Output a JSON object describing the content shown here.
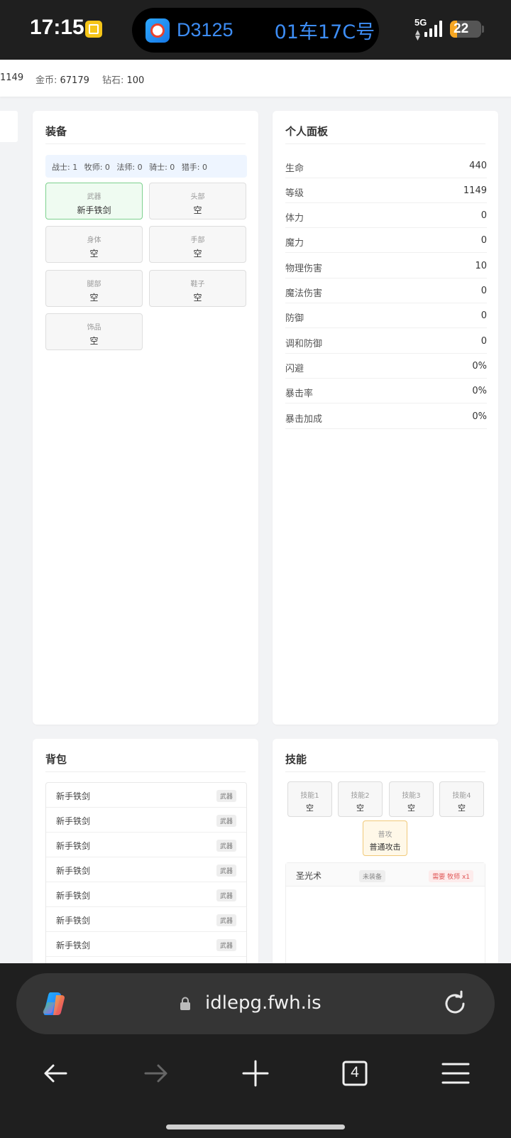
{
  "status_bar": {
    "time": "17:15",
    "train_number": "D3125",
    "seat": "01车17C号",
    "network": "5G",
    "battery_level": "22",
    "battery_fraction": 0.22
  },
  "top_stats": {
    "level_fragment": "1149",
    "gold_label": "金币: ",
    "gold_value": "67179",
    "diamond_label": "钻石: ",
    "diamond_value": "100"
  },
  "equipment": {
    "title": "装备",
    "job_counts": [
      "战士: 1",
      "牧师: 0",
      "法师: 0",
      "骑士: 0",
      "猎手: 0"
    ],
    "slots": [
      {
        "name": "武器",
        "value": "新手铁剑",
        "equipped": true
      },
      {
        "name": "头部",
        "value": "空",
        "equipped": false
      },
      {
        "name": "身体",
        "value": "空",
        "equipped": false
      },
      {
        "name": "手部",
        "value": "空",
        "equipped": false
      },
      {
        "name": "腿部",
        "value": "空",
        "equipped": false
      },
      {
        "name": "鞋子",
        "value": "空",
        "equipped": false
      },
      {
        "name": "饰品",
        "value": "空",
        "equipped": false
      }
    ]
  },
  "personal_panel": {
    "title": "个人面板",
    "stats": [
      {
        "label": "生命",
        "value": "440"
      },
      {
        "label": "等级",
        "value": "1149"
      },
      {
        "label": "体力",
        "value": "0"
      },
      {
        "label": "魔力",
        "value": "0"
      },
      {
        "label": "物理伤害",
        "value": "10"
      },
      {
        "label": "魔法伤害",
        "value": "0"
      },
      {
        "label": "防御",
        "value": "0"
      },
      {
        "label": "调和防御",
        "value": "0"
      },
      {
        "label": "闪避",
        "value": "0%"
      },
      {
        "label": "暴击率",
        "value": "0%"
      },
      {
        "label": "暴击加成",
        "value": "0%"
      }
    ]
  },
  "backpack": {
    "title": "背包",
    "items": [
      {
        "name": "新手铁剑",
        "tag": "武器"
      },
      {
        "name": "新手铁剑",
        "tag": "武器"
      },
      {
        "name": "新手铁剑",
        "tag": "武器"
      },
      {
        "name": "新手铁剑",
        "tag": "武器"
      },
      {
        "name": "新手铁剑",
        "tag": "武器"
      },
      {
        "name": "新手铁剑",
        "tag": "武器"
      },
      {
        "name": "新手铁剑",
        "tag": "武器"
      }
    ]
  },
  "skills": {
    "title": "技能",
    "slots": [
      {
        "name": "技能1",
        "value": "空"
      },
      {
        "name": "技能2",
        "value": "空"
      },
      {
        "name": "技能3",
        "value": "空"
      },
      {
        "name": "技能4",
        "value": "空"
      }
    ],
    "basic": {
      "name": "普攻",
      "value": "普通攻击"
    },
    "list": [
      {
        "name": "圣光术",
        "status": "未装备",
        "requirement": "需要 牧师 x1"
      }
    ]
  },
  "browser": {
    "url": "idlepg.fwh.is",
    "tab_count": "4"
  },
  "colors": {
    "accent_blue": "#3d8df5",
    "equipped_border": "#7dd18e",
    "basic_attack_border": "#f0c97a",
    "requirement_red": "#e05555",
    "battery_orange": "#f5a623"
  }
}
